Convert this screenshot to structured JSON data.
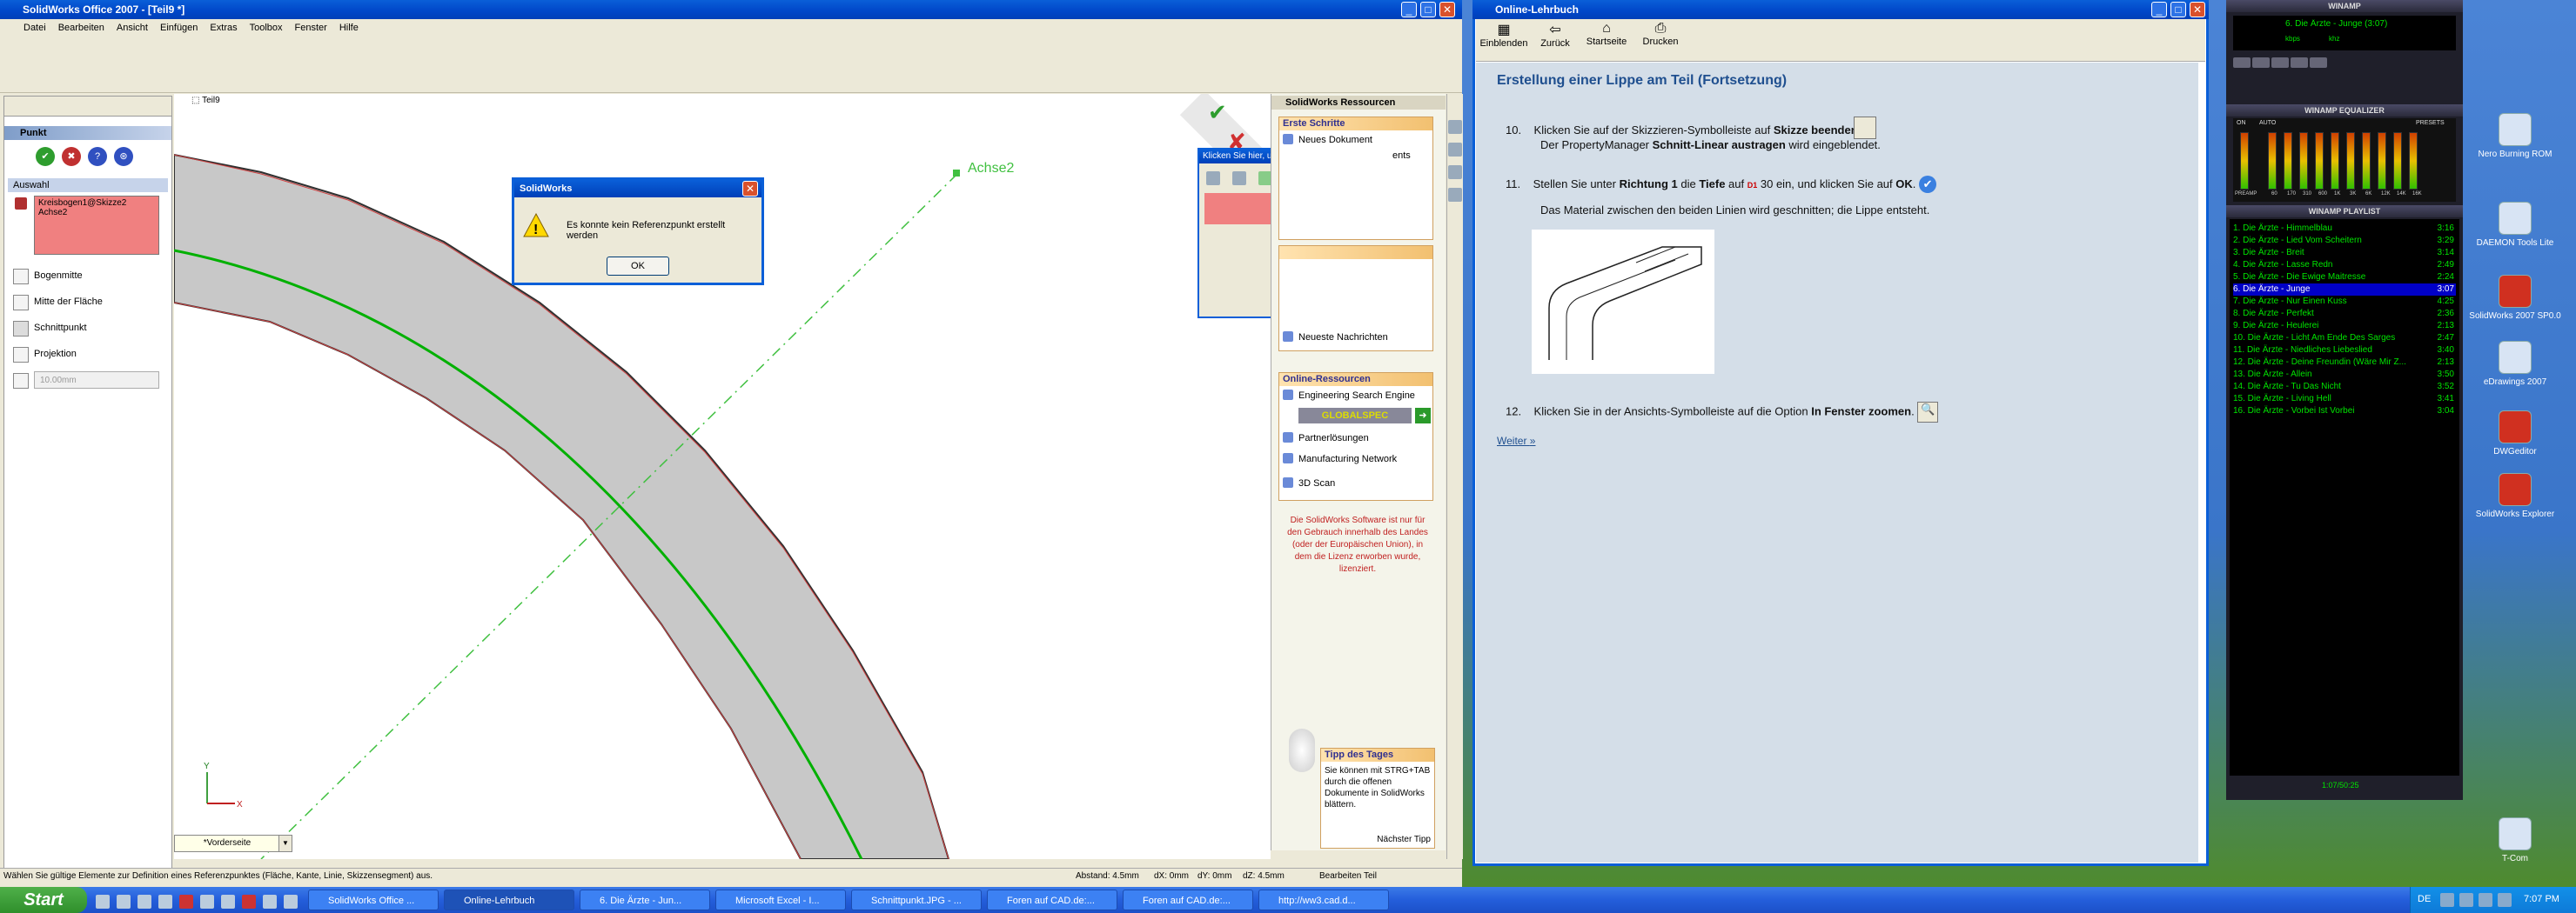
{
  "solidworks": {
    "title": "SolidWorks Office 2007 - [Teil9 *]",
    "menu": [
      "Datei",
      "Bearbeiten",
      "Ansicht",
      "Einfügen",
      "Extras",
      "Toolbox",
      "Fenster",
      "Hilfe"
    ],
    "tree_root": "Teil9",
    "feature_manager": {
      "title": "Punkt",
      "section": "Auswahl",
      "selection_lines": [
        "Kreisbogen1@Skizze2",
        "Achse2"
      ],
      "options": [
        "Bogenmitte",
        "Mitte der Fläche",
        "Schnittpunkt",
        "Projektion"
      ],
      "distance_value": "10.00mm"
    },
    "axis_label": "Achse2",
    "view_label": "*Vorderseite",
    "triad": {
      "x": "X",
      "y": "Y"
    },
    "dialog": {
      "title": "SolidWorks",
      "message": "Es konnte kein Referenzpunkt erstellt werden",
      "ok_label": "OK"
    },
    "measure_popup": {
      "title": "Klicken Sie hier, um zu messen"
    },
    "taskpane": {
      "title": "SolidWorks Ressourcen",
      "first_steps": {
        "header": "Erste Schritte",
        "items": [
          "Neues Dokument"
        ],
        "partial_text": "ents"
      },
      "news_item": "Neueste Nachrichten",
      "online": {
        "header": "Online-Ressourcen",
        "items": [
          "Engineering Search Engine",
          "Partnerlösungen",
          "Manufacturing Network",
          "3D Scan"
        ],
        "globalspec": "GLOBALSPEC"
      },
      "license_note": "Die SolidWorks Software ist nur für den Gebrauch innerhalb des Landes (oder der Europäischen Union), in dem die Lizenz erworben wurde, lizenziert.",
      "tip": {
        "header": "Tipp des Tages",
        "text": "Sie können mit STRG+TAB durch die offenen Dokumente in SolidWorks blättern.",
        "next": "Nächster Tipp"
      }
    },
    "statusbar": {
      "message": "Wählen Sie gültige Elemente zur Definition eines Referenzpunktes (Fläche, Kante, Linie, Skizzensegment) aus.",
      "distance": "Abstand: 4.5mm",
      "dx": "dX: 0mm",
      "dy": "dY: 0mm",
      "dz": "dZ: 4.5mm",
      "mode": "Bearbeiten Teil"
    }
  },
  "help": {
    "title": "Online-Lehrbuch",
    "toolbar": [
      "Einblenden",
      "Zurück",
      "Startseite",
      "Drucken"
    ],
    "heading": "Erstellung einer Lippe am Teil (Fortsetzung)",
    "steps": [
      {
        "num": "10.",
        "parts": [
          "Klicken Sie auf der Skizzieren-Symbolleiste auf ",
          "Skizze beenden",
          "."
        ],
        "line2_parts": [
          "Der PropertyManager ",
          "Schnitt-Linear austragen",
          " wird eingeblendet."
        ]
      },
      {
        "num": "11.",
        "parts": [
          "Stellen Sie unter ",
          "Richtung 1",
          " die ",
          "Tiefe",
          " auf ",
          "30",
          " ein, und klicken Sie auf ",
          "OK",
          "."
        ],
        "line2": "Das Material zwischen den beiden Linien wird geschnitten; die Lippe entsteht.",
        "icon_label": "D1"
      },
      {
        "num": "12.",
        "parts": [
          "Klicken Sie in der Ansichts-Symbolleiste auf die Option ",
          "In Fenster zoomen",
          "."
        ]
      }
    ],
    "next": "Weiter"
  },
  "winamp": {
    "title": "WINAMP",
    "now_playing": "6. Die Ärzte - Junge (3:07)",
    "kbps": "kbps",
    "khz": "khz",
    "eq_title": "WINAMP EQUALIZER",
    "eq_on": "ON",
    "eq_auto": "AUTO",
    "eq_presets": "PRESETS",
    "eq_labels": [
      "PREAMP",
      "60",
      "170",
      "310",
      "600",
      "1K",
      "3K",
      "6K",
      "12K",
      "14K",
      "16K"
    ],
    "playlist_title": "WINAMP PLAYLIST",
    "playlist": [
      {
        "title": "1. Die Ärzte - Himmelblau",
        "dur": "3:16"
      },
      {
        "title": "2. Die Ärzte - Lied Vom Scheitern",
        "dur": "3:29"
      },
      {
        "title": "3. Die Ärzte - Breit",
        "dur": "3:14"
      },
      {
        "title": "4. Die Ärzte - Lasse Redn",
        "dur": "2:49"
      },
      {
        "title": "5. Die Ärzte - Die Ewige Maitresse",
        "dur": "2:24"
      },
      {
        "title": "6. Die Ärzte - Junge",
        "dur": "3:07"
      },
      {
        "title": "7. Die Ärzte - Nur Einen Kuss",
        "dur": "4:25"
      },
      {
        "title": "8. Die Ärzte - Perfekt",
        "dur": "2:36"
      },
      {
        "title": "9. Die Ärzte - Heulerei",
        "dur": "2:13"
      },
      {
        "title": "10. Die Ärzte - Licht Am Ende Des Sarges",
        "dur": "2:47"
      },
      {
        "title": "11. Die Ärzte - Niedliches Liebeslied",
        "dur": "3:40"
      },
      {
        "title": "12. Die Ärzte - Deine Freundin (Wäre Mir Z...",
        "dur": "2:13"
      },
      {
        "title": "13. Die Ärzte - Allein",
        "dur": "3:50"
      },
      {
        "title": "14. Die Ärzte - Tu Das Nicht",
        "dur": "3:52"
      },
      {
        "title": "15. Die Ärzte - Living Hell",
        "dur": "3:41"
      },
      {
        "title": "16. Die Ärzte - Vorbei Ist Vorbei",
        "dur": "3:04"
      }
    ],
    "selected_index": 5,
    "time_display": "1:07/50:25"
  },
  "desktop_icons": [
    "Nero Burning ROM",
    "DAEMON Tools Lite",
    "SolidWorks 2007 SP0.0",
    "eDrawings 2007",
    "DWGeditor",
    "SolidWorks Explorer",
    "T-Com"
  ],
  "taskbar": {
    "start": "Start",
    "tasks": [
      "SolidWorks Office ...",
      "Online-Lehrbuch",
      "6. Die Ärzte - Jun...",
      "Microsoft Excel - I...",
      "Schnittpunkt.JPG - ...",
      "Foren auf CAD.de:...",
      "Foren auf CAD.de:...",
      "http://ww3.cad.d..."
    ],
    "active_index": 1,
    "lang": "DE",
    "clock": "7:07 PM"
  },
  "colors": {
    "selection_pink": "#f08080",
    "model_gray": "#c8c8c8",
    "sketch_green": "#00b000",
    "axis_green": "#40c040",
    "xp_blue": "#0a5fd8"
  }
}
